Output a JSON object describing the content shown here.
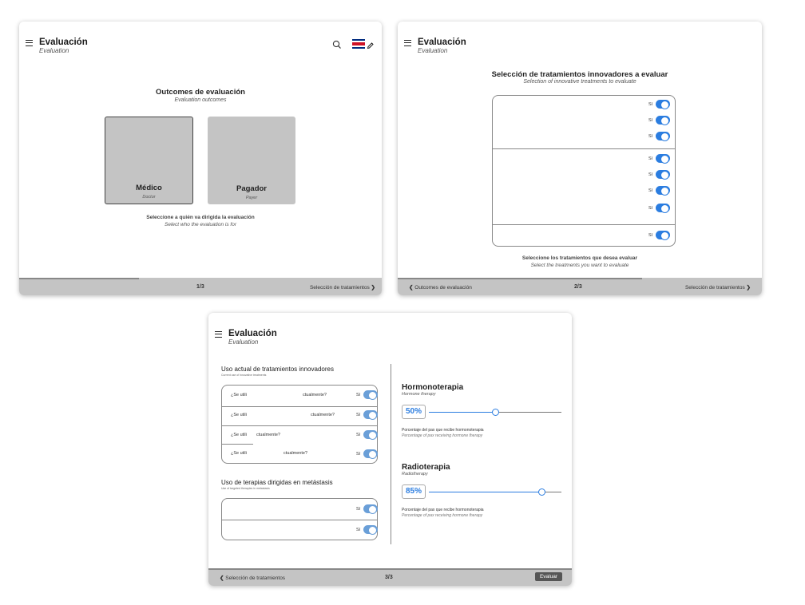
{
  "common": {
    "title": "Evaluación",
    "subtitle": "Evaluation",
    "toggle_label": "Sí"
  },
  "screen1": {
    "heading": "Outcomes de evaluación",
    "heading_sub": "Evaluation outcomes",
    "cards": [
      {
        "label": "Médico",
        "sub": "Doctor"
      },
      {
        "label": "Pagador",
        "sub": "Payer"
      }
    ],
    "instruction": "Seleccione a quién va dirigida la evaluación",
    "instruction_sub": "Select who the evaluation is for",
    "page": "1/3",
    "next": "Selección de tratamientos",
    "progress": 0.33
  },
  "screen2": {
    "heading": "Selección de tratamientos innovadores a evaluar",
    "heading_sub": "Selection of innovative treatments to evaluate",
    "instruction": "Seleccione los tratamientos que desea evaluar",
    "instruction_sub": "Select the treatments you want to evaluate",
    "prev": "Outcomes de evaluación",
    "page": "2/3",
    "next": "Selección de tratamientos",
    "progress": 0.67
  },
  "screen3": {
    "section1_title": "Uso actual de tratamientos innovadores",
    "section1_sub": "Current use of innovative treatments",
    "rows": [
      {
        "q1": "¿Se utili",
        "q2": "ctualmente?"
      },
      {
        "q1": "¿Se utili",
        "q2": "ctualmente?"
      },
      {
        "q1": "¿Se utili",
        "q2": "ctualmente?"
      },
      {
        "q1": "¿Se utili",
        "q2": "ctualmente?"
      }
    ],
    "section2_title": "Uso de terapias dirigidas en metástasis",
    "section2_sub": "Use of targeted therapies in metastasis",
    "therapies": [
      {
        "name": "Hormonoterapia",
        "name_sub": "Hormone therapy",
        "value": "50%",
        "level": 0.5,
        "desc": "Porcentaje del pax que recibe hormonoterapia",
        "desc_sub": "Percentage of pax receiving hormone therapy"
      },
      {
        "name": "Radioterapia",
        "name_sub": "Radiotherapy",
        "value": "85%",
        "level": 0.85,
        "desc": "Porcentaje del pax que recibe hormonoterapia",
        "desc_sub": "Percentage of pax receiving hormone therapy"
      }
    ],
    "prev": "Selección de tratamientos",
    "page": "3/3",
    "submit": "Evaluar"
  },
  "colors": {
    "accent": "#2b7de0",
    "card": "#c4c4c4",
    "footer": "#c4c4c4"
  }
}
